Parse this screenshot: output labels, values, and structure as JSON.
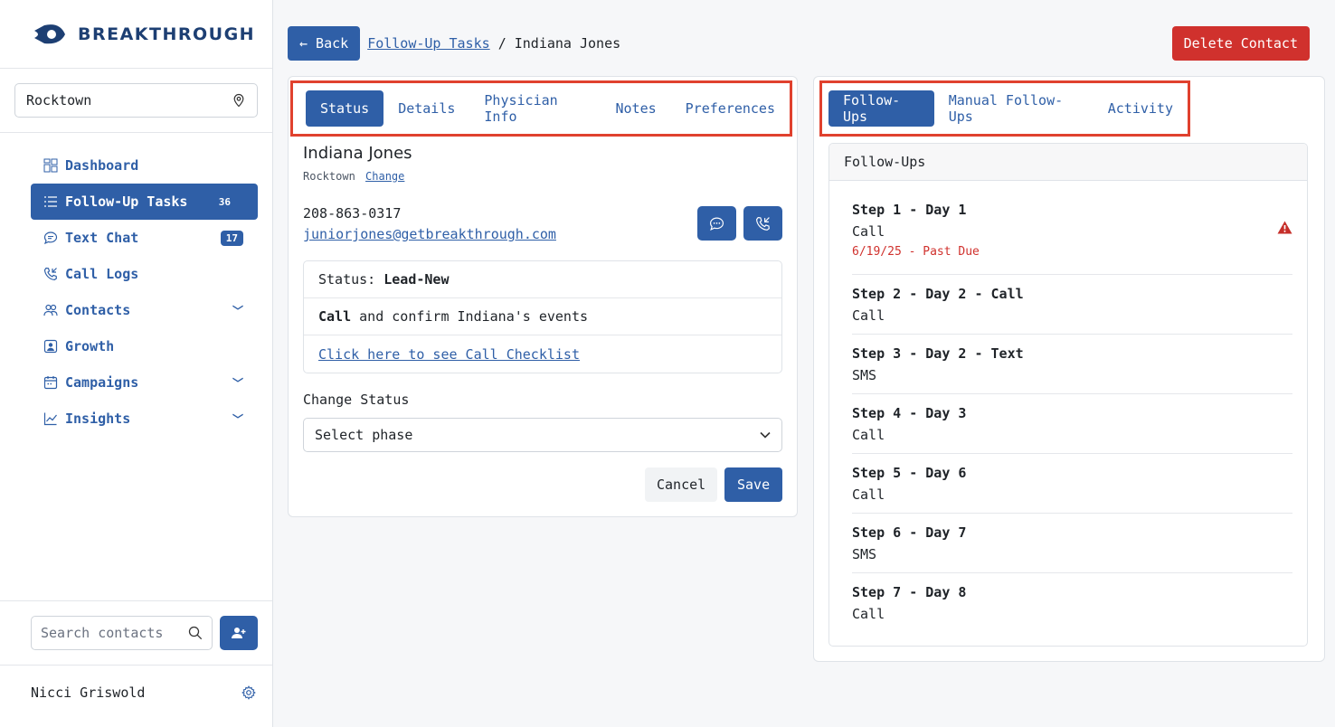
{
  "brand": {
    "name": "BREAKTHROUGH"
  },
  "sidebar": {
    "location": "Rocktown",
    "items": [
      {
        "label": "Dashboard"
      },
      {
        "label": "Follow-Up Tasks",
        "badge": "36"
      },
      {
        "label": "Text Chat",
        "badge": "17"
      },
      {
        "label": "Call Logs"
      },
      {
        "label": "Contacts"
      },
      {
        "label": "Growth"
      },
      {
        "label": "Campaigns"
      },
      {
        "label": "Insights"
      }
    ],
    "search_placeholder": "Search contacts",
    "user_name": "Nicci Griswold"
  },
  "topbar": {
    "back_label": "← Back",
    "breadcrumb_link": "Follow-Up Tasks",
    "breadcrumb_sep": "/",
    "breadcrumb_current": "Indiana Jones",
    "delete_label": "Delete Contact"
  },
  "left_tabs": [
    "Status",
    "Details",
    "Physician Info",
    "Notes",
    "Preferences"
  ],
  "contact": {
    "name": "Indiana Jones",
    "location": "Rocktown",
    "change_label": "Change",
    "phone": "208-863-0317",
    "email": "juniorjones@getbreakthrough.com"
  },
  "status_box": {
    "status_prefix": "Status:",
    "status_value": "Lead-New",
    "action_bold": "Call",
    "action_rest": "and confirm Indiana's events",
    "checklist_link": "Click here to see Call Checklist"
  },
  "change_status": {
    "label": "Change Status",
    "select_value": "Select phase",
    "cancel_label": "Cancel",
    "save_label": "Save"
  },
  "right_tabs": [
    "Follow-Ups",
    "Manual Follow-Ups",
    "Activity"
  ],
  "followups": {
    "header": "Follow-Ups",
    "items": [
      {
        "title": "Step 1 - Day 1",
        "type": "Call",
        "due": "6/19/25 - Past Due"
      },
      {
        "title": "Step 2 - Day 2 - Call",
        "type": "Call"
      },
      {
        "title": "Step 3 - Day 2 - Text",
        "type": "SMS"
      },
      {
        "title": "Step 4 - Day 3",
        "type": "Call"
      },
      {
        "title": "Step 5 - Day 6",
        "type": "Call"
      },
      {
        "title": "Step 6 - Day 7",
        "type": "SMS"
      },
      {
        "title": "Step 7 - Day 8",
        "type": "Call"
      }
    ]
  },
  "colors": {
    "primary": "#2f5fa7",
    "danger": "#d0312d",
    "highlight": "#e0412e"
  }
}
